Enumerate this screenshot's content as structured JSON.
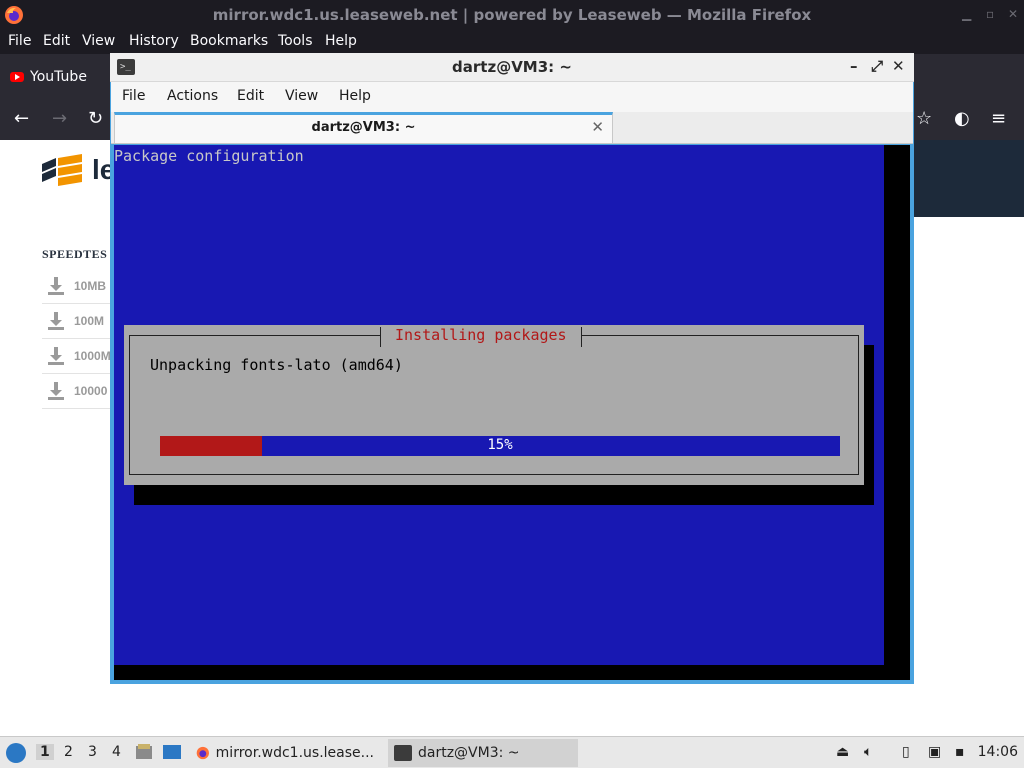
{
  "firefox": {
    "window_title": "mirror.wdc1.us.leaseweb.net | powered by Leaseweb — Mozilla Firefox",
    "menu": [
      "File",
      "Edit",
      "View",
      "History",
      "Bookmarks",
      "Tools",
      "Help"
    ],
    "bookmarks": [
      {
        "label": "YouTube",
        "icon": "youtube-icon"
      }
    ],
    "page": {
      "logo_text": "le",
      "speedtest_title": "SPEEDTES",
      "speedtest_items": [
        "10MB",
        "100M",
        "1000M",
        "10000"
      ]
    }
  },
  "terminal": {
    "window_title": "dartz@VM3: ~",
    "menu": [
      "File",
      "Actions",
      "Edit",
      "View",
      "Help"
    ],
    "tab_label": "dartz@VM3: ~",
    "screen": {
      "header": "Package configuration",
      "dialog_title": "Installing packages",
      "message": "Unpacking fonts-lato (amd64)",
      "progress_percent": 15,
      "progress_label": "15%"
    },
    "colors": {
      "dialog_bg": "#1818b2",
      "dialog_box": "#aaaaaa",
      "accent_red": "#b21818"
    }
  },
  "taskbar": {
    "workspaces": [
      "1",
      "2",
      "3",
      "4"
    ],
    "active_workspace": "1",
    "tasks": [
      {
        "label": "mirror.wdc1.us.lease...",
        "icon": "firefox-icon"
      },
      {
        "label": "dartz@VM3: ~",
        "icon": "terminal-icon"
      }
    ],
    "clock": "14:06"
  }
}
